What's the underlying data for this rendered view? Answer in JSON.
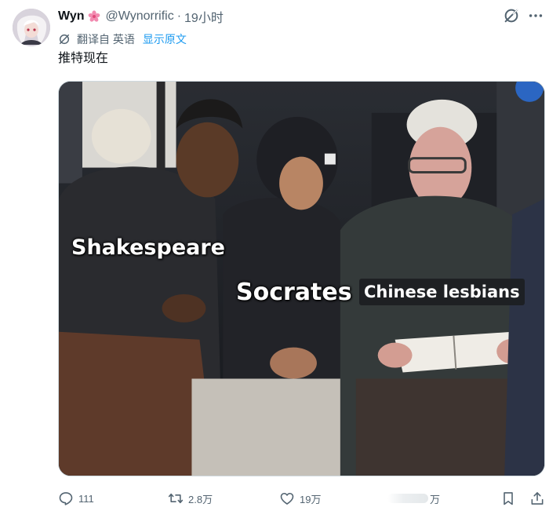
{
  "user": {
    "display_name": "Wyn",
    "badge_icon": "sakura-icon",
    "handle": "@Wynorrific",
    "separator": "·",
    "time": "19小时"
  },
  "translation": {
    "from_label": "翻译自 英语",
    "show_original": "显示原文"
  },
  "tweet_text": "推特现在",
  "media": {
    "captions": {
      "shakespeare": "Shakespeare",
      "socrates": "Socrates",
      "chinese_lesbians": "Chinese lesbians"
    }
  },
  "actions": {
    "replies": "111",
    "retweets": "2.8万",
    "likes": "19万",
    "views": "万"
  },
  "colors": {
    "accent": "#1d9bf0",
    "secondary_text": "#536471",
    "primary_text": "#0f1419"
  }
}
